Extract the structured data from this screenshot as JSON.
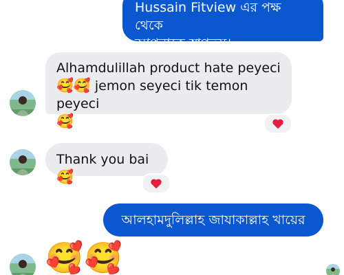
{
  "messages": {
    "outgoing_welcome": {
      "line1": "Hussain Fitview এর পক্ষ থেকে",
      "line2": "আপনাকে স্বাগতম।"
    },
    "incoming_1": {
      "line1": "Alhamdulillah product hate peyeci",
      "line2_emoji": "🥰🥰",
      "line2_text": " jemon seyeci tik temon peyeci",
      "line3_emoji": "🥰"
    },
    "incoming_2": {
      "text": "Thank you bai",
      "emoji": "🥰"
    },
    "outgoing_reply": {
      "text": "আলহামদুলিল্লাহ জাযাকাল্লাহ খায়ের"
    },
    "incoming_3": {
      "emojis": "🥰🥰"
    }
  },
  "reactions": {
    "incoming_1": "heart-icon",
    "incoming_2": "heart-icon"
  },
  "colors": {
    "outgoing_bubble": "#0b57d0",
    "incoming_bubble": "#ebecee",
    "reaction_heart": "#e41e3f"
  }
}
